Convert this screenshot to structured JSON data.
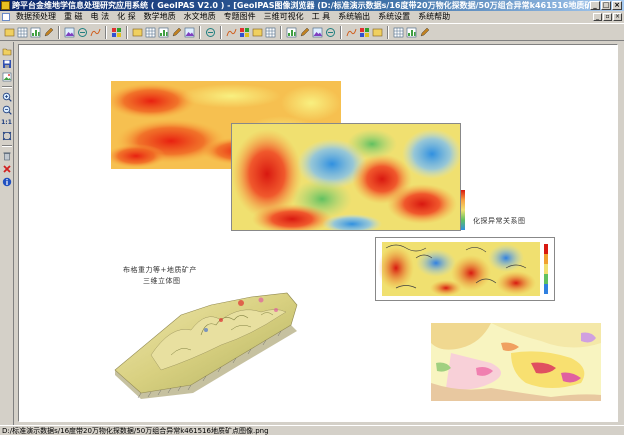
{
  "window": {
    "title": "跨平台金维地学信息处理研究应用系统 ( GeoIPAS V2.0 )  - [GeoIPAS图像浏览器 (D:/标准演示数据s/16度带20万物化探数据/50万组合异常k461516地质矿点图..."
  },
  "menu": {
    "items": [
      "数据预处理",
      "重 磁",
      "电 法",
      "化 探",
      "数学地质",
      "水文地质",
      "专题图件",
      "三维可视化",
      "工 具",
      "系统输出",
      "系统设置",
      "系统帮助"
    ]
  },
  "toolbar": {
    "icons": [
      "open-file-icon",
      "table-icon",
      "chart-icon",
      "edit-icon",
      "image-icon",
      "printer-icon",
      "arrow-icon",
      "profile-icon",
      "grid-icon",
      "contour-icon",
      "filter-icon",
      "wave-icon",
      "rgb-icon",
      "shading-icon",
      "histogram-icon",
      "stats-icon",
      "classify-icon",
      "map-icon",
      "overlay-icon",
      "legend-icon",
      "layers-icon",
      "scale-icon",
      "north-icon",
      "export-icon",
      "folder-icon",
      "color-icon",
      "help-icon",
      "about-icon"
    ]
  },
  "sidebar": {
    "icons": [
      "open-icon",
      "save-icon",
      "image-icon",
      "zoom-in-icon",
      "zoom-out-icon",
      "actual-size-icon",
      "fit-window-icon",
      "clear-icon",
      "close-icon",
      "info-icon"
    ],
    "actual_size_label": "1:1"
  },
  "canvas": {
    "map_label_1": "化探异常关系图",
    "map_label_2_line1": "布格重力等+地质矿产",
    "map_label_2_line2": "三维立体图"
  },
  "status": {
    "path": "D:/标准演示数据s/16度带20万物化探数据/50万组合异常k461516地质矿点图像.png"
  },
  "colors": {
    "titlebar_start": "#0a246a",
    "titlebar_end": "#a6caf0",
    "chrome": "#d4d0c8",
    "canvas": "#ffffff"
  }
}
